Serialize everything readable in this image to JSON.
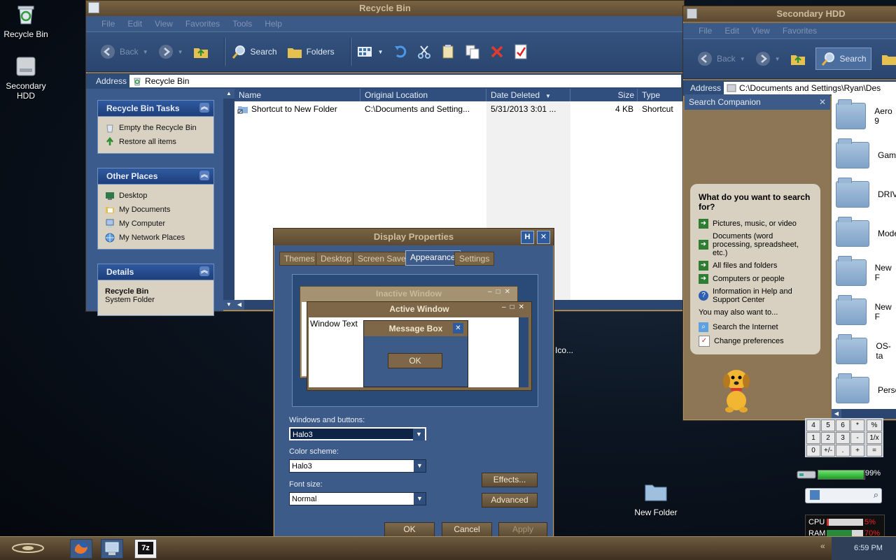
{
  "desktop": {
    "icons": [
      {
        "label": "Recycle Bin"
      },
      {
        "label": "Secondary HDD"
      },
      {
        "label": "New Folder"
      }
    ],
    "partial_label": "Ico..."
  },
  "recycle": {
    "title": "Recycle Bin",
    "menu": [
      "File",
      "Edit",
      "View",
      "Favorites",
      "Tools",
      "Help"
    ],
    "toolbar": {
      "back": "Back",
      "search": "Search",
      "folders": "Folders"
    },
    "address_label": "Address",
    "address_value": "Recycle Bin",
    "tasks_title": "Recycle Bin Tasks",
    "tasks": [
      "Empty the Recycle Bin",
      "Restore all items"
    ],
    "places_title": "Other Places",
    "places": [
      "Desktop",
      "My Documents",
      "My Computer",
      "My Network Places"
    ],
    "details_title": "Details",
    "details_name": "Recycle Bin",
    "details_type": "System Folder",
    "columns": [
      "Name",
      "Original Location",
      "Date Deleted",
      "Size",
      "Type"
    ],
    "row": {
      "name": "Shortcut to New Folder",
      "location": "C:\\Documents and Setting...",
      "date": "5/31/2013 3:01 ...",
      "size": "4 KB",
      "type": "Shortcut"
    }
  },
  "hdd": {
    "title": "Secondary HDD",
    "menu": [
      "File",
      "Edit",
      "View",
      "Favorites"
    ],
    "toolbar": {
      "back": "Back",
      "search": "Search"
    },
    "address_label": "Address",
    "address_value": "C:\\Documents and Settings\\Ryan\\Des",
    "companion_title": "Search Companion",
    "question": "What do you want to search for?",
    "options": [
      "Pictures, music, or video",
      "Documents (word processing, spreadsheet, etc.)",
      "All files and folders",
      "Computers or people",
      "Information in Help and Support Center"
    ],
    "also": "You may also want to...",
    "also_options": [
      "Search the Internet",
      "Change preferences"
    ],
    "folders": [
      "Aero 9",
      "Game",
      "DRIVE",
      "Model",
      "New F",
      "New F",
      "OS-ta",
      "Perso"
    ]
  },
  "display": {
    "title": "Display Properties",
    "help_btn": "H",
    "tabs": [
      "Themes",
      "Desktop",
      "Screen Saver",
      "Appearance",
      "Settings"
    ],
    "preview": {
      "inactive": "Inactive Window",
      "active": "Active Window",
      "window_text": "Window Text",
      "message": "Message Box",
      "ok": "OK"
    },
    "windows_label": "Windows and buttons:",
    "windows_value": "Halo3",
    "scheme_label": "Color scheme:",
    "scheme_value": "Halo3",
    "font_label": "Font size:",
    "font_value": "Normal",
    "effects": "Effects...",
    "advanced": "Advanced",
    "ok": "OK",
    "cancel": "Cancel",
    "apply": "Apply"
  },
  "calc": {
    "rows": [
      [
        "4",
        "5",
        "6",
        "*",
        "%"
      ],
      [
        "1",
        "2",
        "3",
        "-",
        "1/x"
      ],
      [
        "0",
        "+/-",
        ".",
        "+",
        "="
      ]
    ]
  },
  "gadgets": {
    "battery": "99%",
    "cpu_label": "CPU",
    "cpu_value": "5%",
    "ram_label": "RAM",
    "ram_value": "70%",
    "cpu_level": 0.05,
    "ram_level": 0.7,
    "battery_level": 0.99
  },
  "taskbar": {
    "clock": "6:59 PM",
    "seven_zip": "7z"
  }
}
